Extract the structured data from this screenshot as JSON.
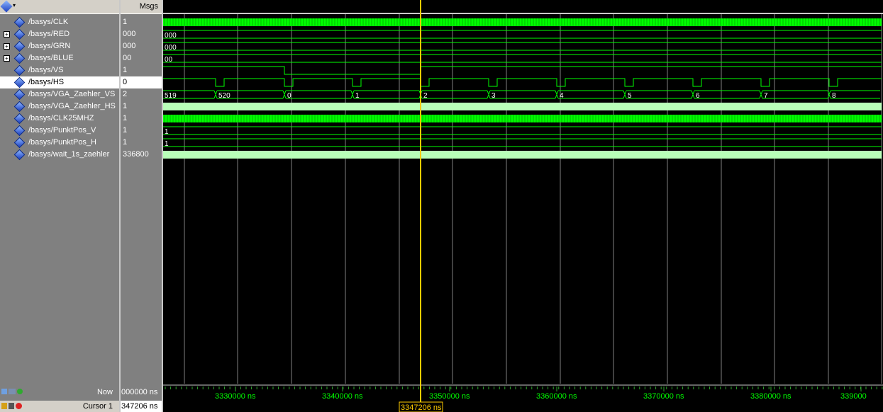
{
  "header": {
    "msgs_label": "Msgs"
  },
  "signals": [
    {
      "name": "/basys/CLK",
      "value": "1",
      "expandable": false,
      "type": "clock"
    },
    {
      "name": "/basys/RED",
      "value": "000",
      "expandable": true,
      "type": "bus",
      "bus_labels": [
        "000"
      ]
    },
    {
      "name": "/basys/GRN",
      "value": "000",
      "expandable": true,
      "type": "bus",
      "bus_labels": [
        "000"
      ]
    },
    {
      "name": "/basys/BLUE",
      "value": "00",
      "expandable": true,
      "type": "bus",
      "bus_labels": [
        "00"
      ]
    },
    {
      "name": "/basys/VS",
      "value": "1",
      "expandable": false,
      "type": "vs"
    },
    {
      "name": "/basys/HS",
      "value": "0",
      "expandable": false,
      "type": "hs",
      "selected": true
    },
    {
      "name": "/basys/VGA_Zaehler_VS",
      "value": "2",
      "expandable": false,
      "type": "counter",
      "bus_labels": [
        "519",
        "520",
        "0",
        "1",
        "2",
        "3",
        "4",
        "5",
        "6",
        "7",
        "8"
      ]
    },
    {
      "name": "/basys/VGA_Zaehler_HS",
      "value": "1",
      "expandable": false,
      "type": "solid"
    },
    {
      "name": "/basys/CLK25MHZ",
      "value": "1",
      "expandable": false,
      "type": "clock"
    },
    {
      "name": "/basys/PunktPos_V",
      "value": "1",
      "expandable": false,
      "type": "bus",
      "bus_labels": [
        "1"
      ]
    },
    {
      "name": "/basys/PunktPos_H",
      "value": "1",
      "expandable": false,
      "type": "bus",
      "bus_labels": [
        "1"
      ]
    },
    {
      "name": "/basys/wait_1s_zaehler",
      "value": "336800",
      "expandable": false,
      "type": "solid"
    }
  ],
  "footer": {
    "now_label": "Now",
    "now_value": "000000 ns",
    "cursor_label": "Cursor 1",
    "cursor_value": "347206 ns",
    "cursor_flag": "3347206 ns"
  },
  "timeline": {
    "tick_labels": [
      "3330000 ns",
      "3340000 ns",
      "3350000 ns",
      "3360000 ns",
      "3370000 ns",
      "3380000 ns",
      "339000"
    ]
  },
  "colors": {
    "wave_green": "#00ff00",
    "solid_green": "#b8ffb8",
    "cursor": "#ffcc00",
    "grid": "#808080"
  }
}
